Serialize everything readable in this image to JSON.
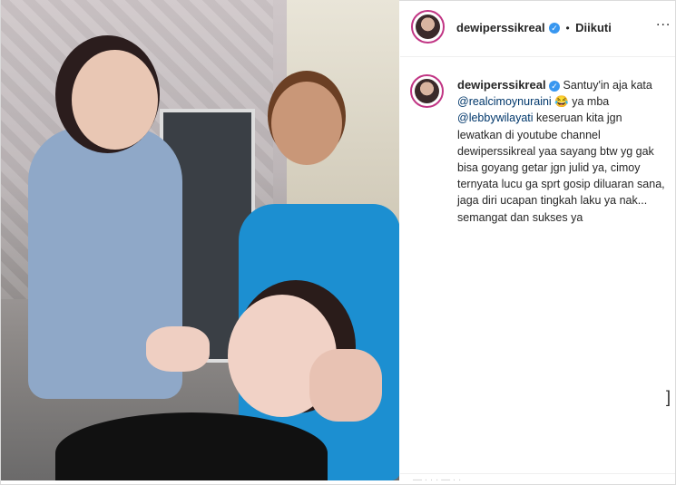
{
  "post": {
    "username": "dewiperssikreal",
    "follow_status": "Diikuti",
    "dot_separator": "•",
    "more_icon": "...",
    "caption": {
      "username": "dewiperssikreal",
      "part1": "Santuy'in aja kata",
      "mention1": "@realcimoynuraini",
      "emoji": "😂",
      "part2": "ya mba",
      "mention2": "@lebbywilayati",
      "part3": "keseruan kita jgn lewatkan di youtube channel dewiperssikreal yaa sayang btw yg gak bisa goyang getar jgn julid ya, cimoy ternyata lucu ga sprt gosip diluaran sana, jaga diri ucapan tingkah laku ya nak... semangat dan sukses ya"
    },
    "scroll_glyph": "]",
    "footer_text": "— · · · — · ·"
  },
  "colors": {
    "mention": "#00376b",
    "verified": "#3897f0",
    "text": "#262626"
  }
}
